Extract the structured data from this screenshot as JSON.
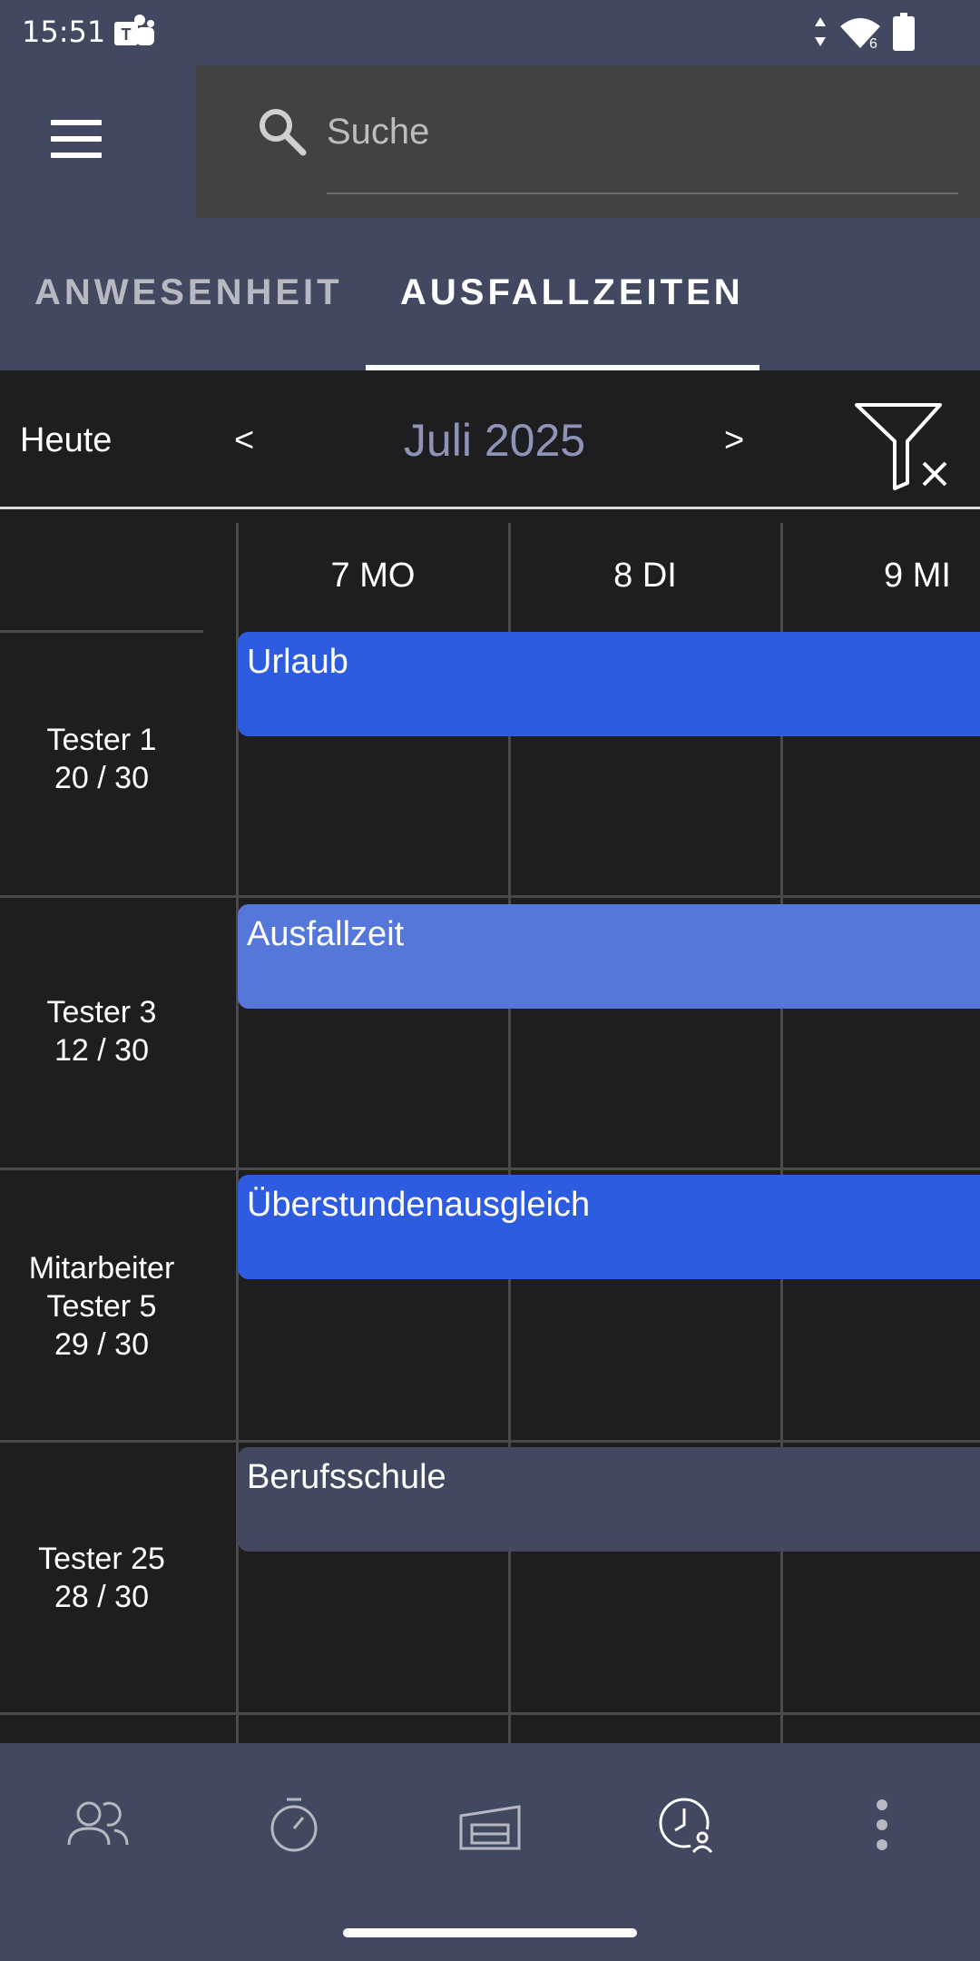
{
  "status_bar": {
    "time": "15:51",
    "network_badge": "6",
    "icons": [
      "teams-icon",
      "network-arrows-icon",
      "wifi-icon",
      "battery-icon"
    ]
  },
  "search": {
    "placeholder": "Suche",
    "value": ""
  },
  "tabs": [
    {
      "label": "ANWESENHEIT",
      "selected": false
    },
    {
      "label": "AUSFALLZEITEN",
      "selected": true
    }
  ],
  "calendar_header": {
    "today_label": "Heute",
    "prev_label": "<",
    "next_label": ">",
    "month_label": "Juli 2025"
  },
  "days": [
    {
      "label": "7 MO"
    },
    {
      "label": "8 DI"
    },
    {
      "label": "9 MI"
    }
  ],
  "rows": [
    {
      "name": "Tester 1",
      "quota": "20 / 30",
      "event": {
        "label": "Urlaub",
        "color": "#2d5ce0"
      }
    },
    {
      "name": "Tester 3",
      "quota": "12 / 30",
      "event": {
        "label": "Ausfallzeit",
        "color": "#5577d9"
      }
    },
    {
      "name": "Mitarbeiter Tester 5",
      "name_line1": "Mitarbeiter",
      "name_line2": "Tester 5",
      "quota": "29 / 30",
      "event": {
        "label": "Überstundenausgleich",
        "color": "#2d5ce0"
      }
    },
    {
      "name": "Tester 25",
      "quota": "28 / 30",
      "event": {
        "label": "Berufsschule",
        "color": "#434861"
      }
    }
  ],
  "bottom_nav": [
    {
      "icon": "people-icon",
      "selected": false
    },
    {
      "icon": "stopwatch-icon",
      "selected": false
    },
    {
      "icon": "garage-icon",
      "selected": false
    },
    {
      "icon": "clock-user-icon",
      "selected": true
    },
    {
      "icon": "more-vertical-icon",
      "selected": false
    }
  ],
  "colors": {
    "header_bg": "#434861",
    "content_bg": "#1e1e20",
    "search_bg": "#424242",
    "accent_month": "#8e93b8"
  }
}
